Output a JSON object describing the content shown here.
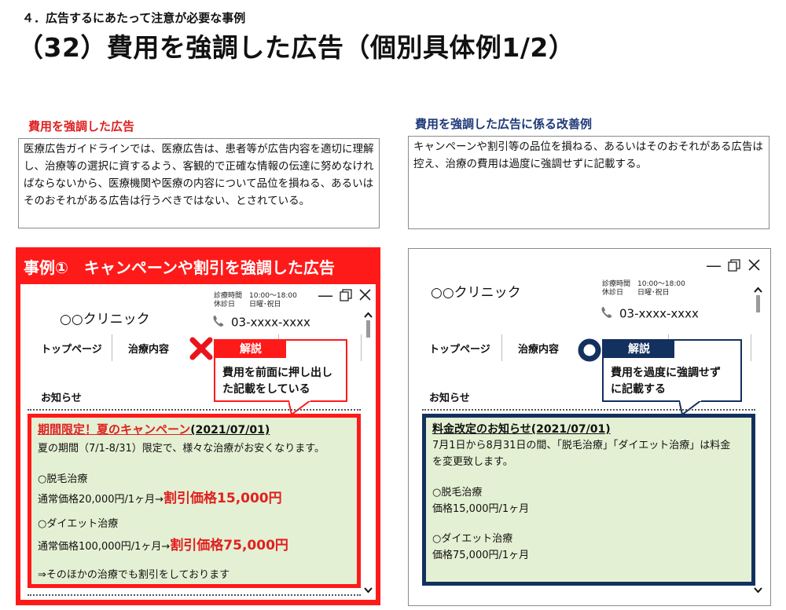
{
  "header": {
    "section": "４．広告するにあたって注意が必要な事例",
    "title": "（32）費用を強調した広告（個別具体例1/2）"
  },
  "left": {
    "subhead": "費用を強調した広告",
    "description": "医療広告ガイドラインでは、医療広告は、患者等が広告内容を適切に理解し、治療等の選択に資するよう、客観的で正確な情報の伝達に努めなければならないから、医療機関や医療の内容について品位を損ねる、あるいはそのおそれがある広告は行うべきではない、とされている。",
    "banner": "事例①　キャンペーンや割引を強調した広告",
    "clinic": "○○クリニック",
    "hours": "診療時間　10:00～18:00",
    "holidays": "休診日　　日曜･祝日",
    "phone": "03-xxxx-xxxx",
    "nav_top": "トップページ",
    "nav_treatment": "治療内容",
    "news": "お知らせ",
    "callout_tag": "解説",
    "callout_line1": "費用を前面に押し出し",
    "callout_line2": "た記載をしている",
    "content": {
      "title": "期間限定！夏のキャンペーン",
      "title_date": "(2021/07/01)",
      "intro": "夏の期間（7/1-8/31）限定で、様々な治療がお安くなります。",
      "item1": "○脱毛治療",
      "item1_regular": "通常価格20,000円/1ヶ月→",
      "item1_discount": "割引価格15,000円",
      "item2": "○ダイエット治療",
      "item2_regular": "通常価格100,000円/1ヶ月→",
      "item2_discount": "割引価格75,000円",
      "footer": "⇒そのほかの治療でも割引をしております"
    }
  },
  "right": {
    "subhead": "費用を強調した広告に係る改善例",
    "description": "キャンペーンや割引等の品位を損ねる、あるいはそのおそれがある広告は控え、治療の費用は過度に強調せずに記載する。",
    "clinic": "○○クリニック",
    "hours": "診療時間　10:00～18:00",
    "holidays": "休診日　　日曜･祝日",
    "phone": "03-xxxx-xxxx",
    "nav_top": "トップページ",
    "nav_treatment": "治療内容",
    "news": "お知らせ",
    "callout_tag": "解説",
    "callout_line1": "費用を過度に強調せず",
    "callout_line2": "に記載する",
    "content": {
      "title": "料金改定のお知らせ(2021/07/01)",
      "line1": "7月1日から8月31日の間、「脱毛治療」「ダイエット治療」は料金",
      "line2": "を変更致します。",
      "item1": "○脱毛治療",
      "item1_price": "価格15,000円/1ヶ月",
      "item2": "○ダイエット治療",
      "item2_price": "価格75,000円/1ヶ月"
    }
  },
  "colors": {
    "accent_red": "#ff1a1a",
    "accent_navy": "#13305e",
    "content_bg": "#e4f0d3"
  },
  "icons": [
    "phone-icon",
    "minimize-icon",
    "maximize-icon",
    "close-icon",
    "scroll-up-icon",
    "scroll-down-icon",
    "cross-mark-icon",
    "circle-mark-icon"
  ]
}
